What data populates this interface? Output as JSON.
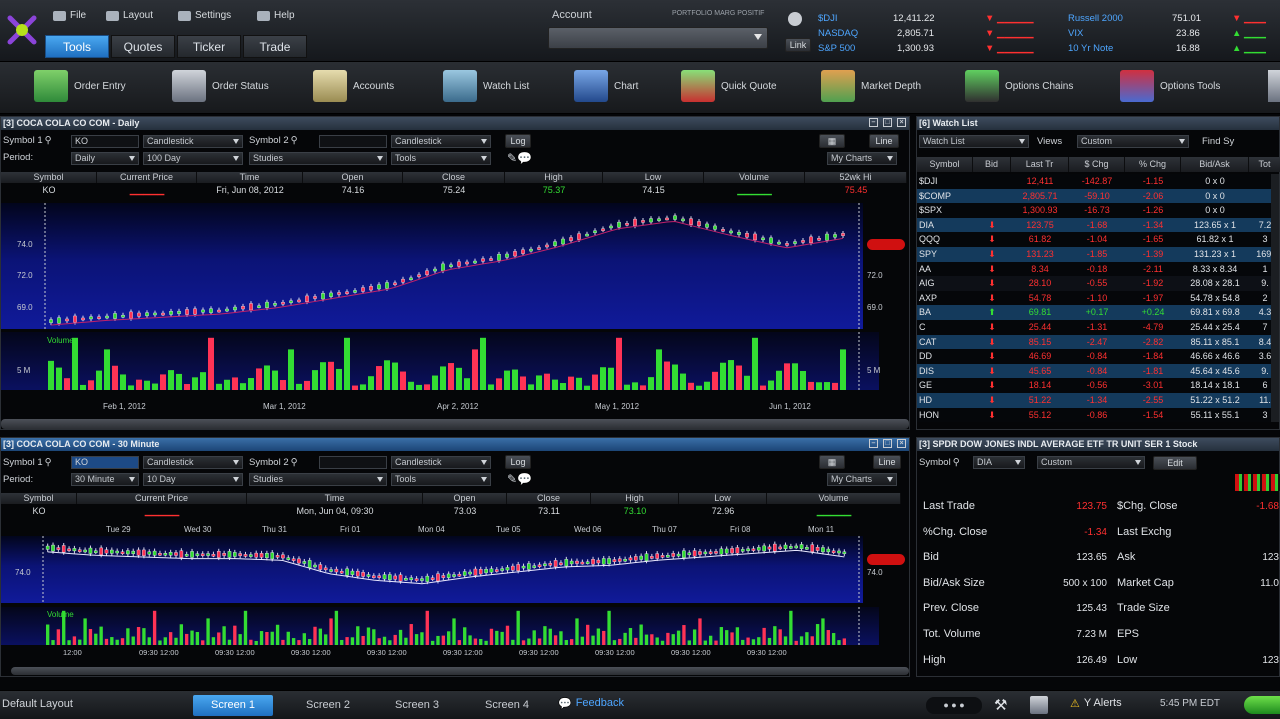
{
  "menu": {
    "file": "File",
    "layout": "Layout",
    "settings": "Settings",
    "help": "Help"
  },
  "nav_tabs": [
    "Tools",
    "Quotes",
    "Ticker",
    "Trade"
  ],
  "account": {
    "label": "Account",
    "value": "PORTFOLIO MARG POSITIF"
  },
  "markets": [
    {
      "name": "$DJI",
      "value": "12,411.22",
      "change": "-",
      "pct": "",
      "name2": "Russell 2000",
      "val2": "751.01",
      "chg2": "-"
    },
    {
      "name": "NASDAQ",
      "value": "2,805.71",
      "change": "-",
      "pct": "",
      "name2": "VIX",
      "val2": "23.86",
      "chg2": "+"
    },
    {
      "name": "S&P 500",
      "value": "1,300.93",
      "change": "-",
      "pct": "",
      "name2": "10 Yr Note",
      "val2": "16.88",
      "chg2": "+"
    }
  ],
  "tools": [
    "Order Entry",
    "Order Status",
    "Accounts",
    "Watch List",
    "Chart",
    "Quick Quote",
    "Market Depth",
    "Options Chains",
    "Options Tools"
  ],
  "chart1": {
    "title": "[3] COCA COLA CO COM - Daily",
    "symbol_lbl": "Symbol 1",
    "symbol": "KO",
    "style": "Candlestick",
    "symbol2_lbl": "Symbol 2",
    "style2": "Candlestick",
    "log": "Log",
    "line": "Line",
    "period_lbl": "Period:",
    "period": "Daily",
    "range": "100 Day",
    "studies": "Studies",
    "tools": "Tools",
    "mycharts": "My Charts",
    "headers": [
      "Symbol",
      "Current Price",
      "Time",
      "Open",
      "Close",
      "High",
      "Low",
      "Volume",
      "52wk Hi"
    ],
    "values": [
      "KO",
      "",
      "Fri, Jun 08, 2012",
      "74.16",
      "75.24",
      "75.37",
      "74.15",
      "",
      "75.45"
    ],
    "yticks": [
      "74.0",
      "72.0",
      "69.0"
    ],
    "xticks": [
      "Feb 1, 2012",
      "Mar 1, 2012",
      "Apr 2, 2012",
      "May 1, 2012",
      "Jun 1, 2012"
    ],
    "volume_lbl": "Volume",
    "vol_tick": "5 M",
    "last_tag": ""
  },
  "chart2": {
    "title": "[3] COCA COLA CO COM - 30 Minute",
    "symbol_lbl": "Symbol 1",
    "symbol": "KO",
    "style": "Candlestick",
    "symbol2_lbl": "Symbol 2",
    "style2": "Candlestick",
    "log": "Log",
    "line": "Line",
    "period_lbl": "Period:",
    "period": "30 Minute",
    "range": "10 Day",
    "studies": "Studies",
    "tools": "Tools",
    "mycharts": "My Charts",
    "headers": [
      "Symbol",
      "Current Price",
      "Time",
      "Open",
      "Close",
      "High",
      "Low",
      "Volume"
    ],
    "values": [
      "KO",
      "",
      "Mon, Jun 04, 09:30",
      "73.03",
      "73.11",
      "73.10",
      "72.96",
      ""
    ],
    "day_ticks": [
      "Tue 29",
      "Wed 30",
      "Thu 31",
      "Fri 01",
      "Mon 04",
      "Tue 05",
      "Wed 06",
      "Thu 07",
      "Fri 08",
      "Mon 11"
    ],
    "time_ticks": [
      "12:00",
      "09:30 12:00",
      "09:30 12:00",
      "09:30 12:00",
      "09:30 12:00",
      "09:30 12:00",
      "09:30 12:00",
      "09:30 12:00",
      "09:30 12:00",
      "09:30 12:00"
    ],
    "ytick": "74.0",
    "volume_lbl": "Volume"
  },
  "watchlist": {
    "title": "[6] Watch List",
    "list": "Watch List",
    "views_lbl": "Views",
    "view": "Custom",
    "find": "Find Sy",
    "headers": [
      "Symbol",
      "Bid",
      "Last Tr",
      "$ Chg",
      "% Chg",
      "Bid/Ask",
      "Tot"
    ],
    "rows": [
      {
        "sym": "$DJI",
        "bid": "",
        "last": "12,411",
        "chg": "-142.87",
        "pct": "-1.15",
        "ba": "0 x 0",
        "tot": ""
      },
      {
        "sym": "$COMP",
        "bid": "",
        "last": "2,805.71",
        "chg": "-59.10",
        "pct": "-2.06",
        "ba": "0 x 0",
        "tot": ""
      },
      {
        "sym": "$SPX",
        "bid": "",
        "last": "1,300.93",
        "chg": "-16.73",
        "pct": "-1.26",
        "ba": "0 x 0",
        "tot": ""
      },
      {
        "sym": "DIA",
        "bid": "",
        "last": "123.75",
        "chg": "-1.68",
        "pct": "-1.34",
        "ba": "123.65 x 1",
        "tot": "7.2"
      },
      {
        "sym": "QQQ",
        "bid": "",
        "last": "61.82",
        "chg": "-1.04",
        "pct": "-1.65",
        "ba": "61.82 x 1",
        "tot": "3"
      },
      {
        "sym": "SPY",
        "bid": "",
        "last": "131.23",
        "chg": "-1.85",
        "pct": "-1.39",
        "ba": "131.23 x 1",
        "tot": "169."
      },
      {
        "sym": "AA",
        "bid": "",
        "last": "8.34",
        "chg": "-0.18",
        "pct": "-2.11",
        "ba": "8.33 x 8.34",
        "tot": "1"
      },
      {
        "sym": "AIG",
        "bid": "",
        "last": "28.10",
        "chg": "-0.55",
        "pct": "-1.92",
        "ba": "28.08 x 28.1",
        "tot": "9."
      },
      {
        "sym": "AXP",
        "bid": "",
        "last": "54.78",
        "chg": "-1.10",
        "pct": "-1.97",
        "ba": "54.78 x 54.8",
        "tot": "2"
      },
      {
        "sym": "BA",
        "bid": "",
        "last": "69.81",
        "chg": "+0.17",
        "pct": "+0.24",
        "ba": "69.81 x 69.8",
        "tot": "4.3"
      },
      {
        "sym": "C",
        "bid": "",
        "last": "25.44",
        "chg": "-1.31",
        "pct": "-4.79",
        "ba": "25.44 x 25.4",
        "tot": "7"
      },
      {
        "sym": "CAT",
        "bid": "",
        "last": "85.15",
        "chg": "-2.47",
        "pct": "-2.82",
        "ba": "85.11 x 85.1",
        "tot": "8.4"
      },
      {
        "sym": "DD",
        "bid": "",
        "last": "46.69",
        "chg": "-0.84",
        "pct": "-1.84",
        "ba": "46.66 x 46.6",
        "tot": "3.6"
      },
      {
        "sym": "DIS",
        "bid": "",
        "last": "45.65",
        "chg": "-0.84",
        "pct": "-1.81",
        "ba": "45.64 x 45.6",
        "tot": "9."
      },
      {
        "sym": "GE",
        "bid": "",
        "last": "18.14",
        "chg": "-0.56",
        "pct": "-3.01",
        "ba": "18.14 x 18.1",
        "tot": "6"
      },
      {
        "sym": "HD",
        "bid": "",
        "last": "51.22",
        "chg": "-1.34",
        "pct": "-2.55",
        "ba": "51.22 x 51.2",
        "tot": "11."
      },
      {
        "sym": "HON",
        "bid": "",
        "last": "55.12",
        "chg": "-0.86",
        "pct": "-1.54",
        "ba": "55.11 x 55.1",
        "tot": "3"
      }
    ]
  },
  "quote": {
    "title": "[3] SPDR DOW JONES INDL AVERAGE ETF TR UNIT SER 1 Stock",
    "symbol_lbl": "Symbol",
    "symbol": "DIA",
    "view": "Custom",
    "edit": "Edit",
    "left": [
      [
        "Last Trade",
        "123.75"
      ],
      [
        "%Chg. Close",
        "-1.34"
      ],
      [
        "Bid",
        "123.65"
      ],
      [
        "Bid/Ask Size",
        "500 x 100"
      ],
      [
        "Prev. Close",
        "125.43"
      ],
      [
        "Tot. Volume",
        "7.23 M"
      ],
      [
        "High",
        "126.49"
      ]
    ],
    "right": [
      [
        "$Chg. Close",
        "-1.68"
      ],
      [
        "Last Exchg",
        ""
      ],
      [
        "Ask",
        "123"
      ],
      [
        "Market Cap",
        "11.0"
      ],
      [
        "Trade Size",
        ""
      ],
      [
        "EPS",
        ""
      ],
      [
        "Low",
        "123"
      ]
    ]
  },
  "status": {
    "layout": "Default Layout",
    "screens": [
      "Screen 1",
      "Screen 2",
      "Screen 3",
      "Screen 4"
    ],
    "feedback": "Feedback",
    "alerts": "Y Alerts",
    "time": "5:45 PM EDT"
  },
  "colors": {
    "up": "#33dd33",
    "down": "#ff3030",
    "accent": "#3a9cf0",
    "chart_bg": "#0b1376"
  },
  "chart_data": [
    {
      "type": "line",
      "title": "COCA COLA CO COM - Daily",
      "ylim": [
        68,
        76
      ],
      "x": [
        "Feb",
        "Mar",
        "Apr",
        "May",
        "Jun"
      ],
      "series": [
        {
          "values": [
            68.5,
            68.8,
            69.0,
            69.2,
            69.6,
            70.2,
            70.8,
            72.0,
            72.6,
            73.5,
            74.6,
            75.1,
            74.2,
            73.4,
            74.0
          ]
        }
      ]
    },
    {
      "type": "line",
      "title": "COCA COLA CO COM - 30 Minute",
      "ylim": [
        72,
        76
      ],
      "series": [
        {
          "values": [
            75.3,
            75.1,
            75.0,
            74.9,
            74.9,
            74.8,
            74.0,
            73.6,
            73.4,
            73.8,
            74.1,
            74.4,
            74.5,
            74.8,
            75.0,
            75.2,
            75.4,
            75.0
          ]
        }
      ]
    }
  ]
}
